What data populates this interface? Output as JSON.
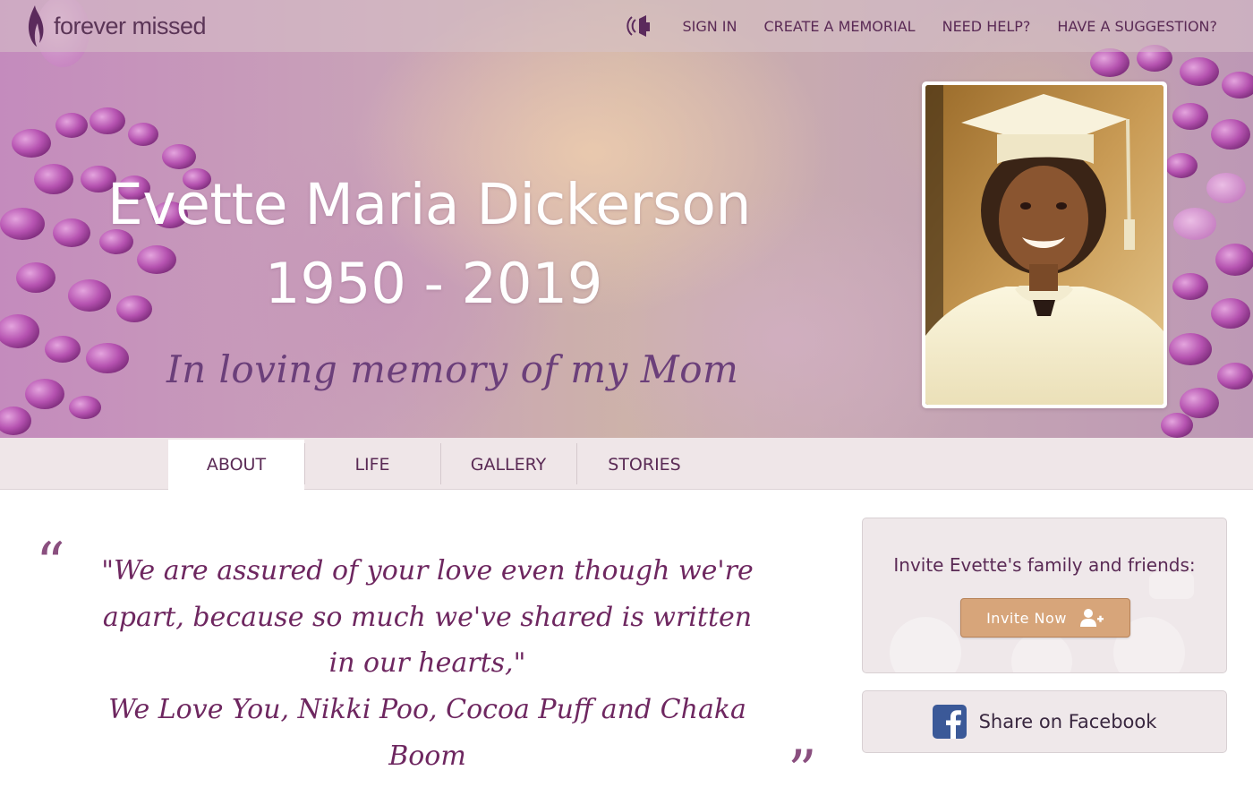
{
  "brand": {
    "logo_text": "forever missed",
    "accent_color": "#5a2a55",
    "button_color": "#d7a57a",
    "facebook_color": "#3b5998"
  },
  "nav": {
    "sound_icon": "speaker-icon",
    "links": [
      "SIGN IN",
      "CREATE A MEMORIAL",
      "NEED HELP?",
      "HAVE A SUGGESTION?"
    ]
  },
  "hero": {
    "name": "Evette Maria Dickerson",
    "dates": "1950 - 2019",
    "tagline": "In loving memory of my Mom"
  },
  "tabs": [
    {
      "label": "ABOUT",
      "active": true
    },
    {
      "label": "LIFE",
      "active": false
    },
    {
      "label": "GALLERY",
      "active": false
    },
    {
      "label": "STORIES",
      "active": false
    }
  ],
  "quote": {
    "open_mark": "“",
    "close_mark": "”",
    "text": "\"We are assured of your love even though we're apart, because so much we've shared is written in our hearts,\"",
    "signature": "We Love You, Nikki Poo, Cocoa Puff and Chaka Boom"
  },
  "sidebar": {
    "invite_label": "Invite Evette's family and friends:",
    "invite_button": "Invite Now",
    "invite_icon": "add-user-icon",
    "facebook_label": "Share on Facebook",
    "facebook_icon": "facebook-icon"
  }
}
